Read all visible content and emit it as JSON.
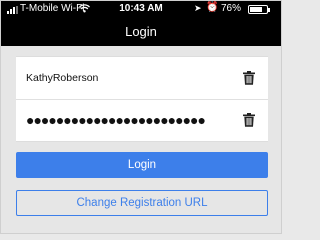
{
  "status_bar": {
    "carrier": "T-Mobile Wi-Fi",
    "time": "10:43 AM",
    "battery_text": "76%",
    "battery_level": 0.76
  },
  "nav": {
    "title": "Login"
  },
  "form": {
    "username": "KathyRoberson",
    "password_masked": "●●●●●●●●●●●●●●●●●●●●●●●●"
  },
  "buttons": {
    "login": "Login",
    "change_registration_url": "Change Registration URL"
  },
  "colors": {
    "accent": "#3d7fea",
    "bar": "#000000",
    "background": "#e6e6e6"
  }
}
